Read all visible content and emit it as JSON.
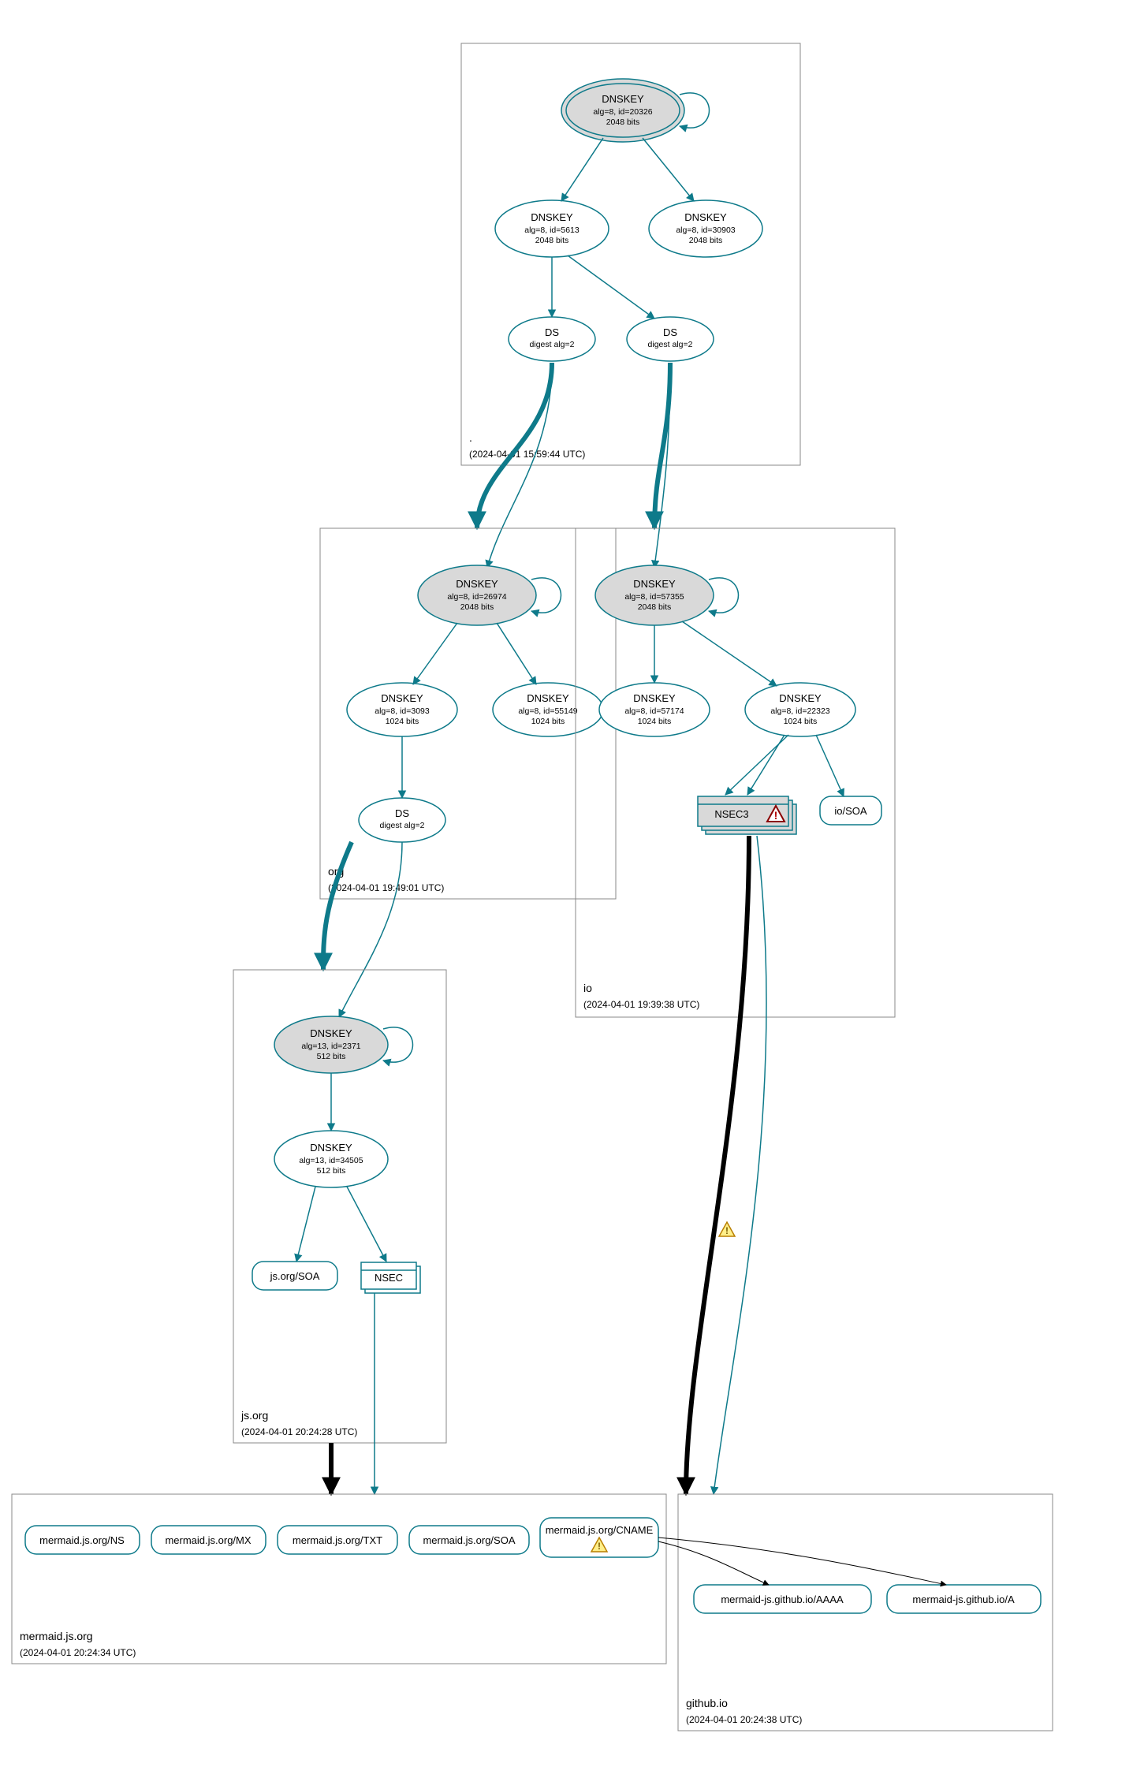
{
  "zones": {
    "root": {
      "label": ".",
      "timestamp": "(2024-04-01 15:59:44 UTC)",
      "nodes": {
        "ksk": {
          "title": "DNSKEY",
          "sub1": "alg=8, id=20326",
          "sub2": "2048 bits"
        },
        "zsk1": {
          "title": "DNSKEY",
          "sub1": "alg=8, id=5613",
          "sub2": "2048 bits"
        },
        "zsk2": {
          "title": "DNSKEY",
          "sub1": "alg=8, id=30903",
          "sub2": "2048 bits"
        },
        "ds1": {
          "title": "DS",
          "sub1": "digest alg=2"
        },
        "ds2": {
          "title": "DS",
          "sub1": "digest alg=2"
        }
      }
    },
    "org": {
      "label": "org",
      "timestamp": "(2024-04-01 19:49:01 UTC)",
      "nodes": {
        "ksk": {
          "title": "DNSKEY",
          "sub1": "alg=8, id=26974",
          "sub2": "2048 bits"
        },
        "zsk1": {
          "title": "DNSKEY",
          "sub1": "alg=8, id=3093",
          "sub2": "1024 bits"
        },
        "zsk2": {
          "title": "DNSKEY",
          "sub1": "alg=8, id=55149",
          "sub2": "1024 bits"
        },
        "ds": {
          "title": "DS",
          "sub1": "digest alg=2"
        }
      }
    },
    "io": {
      "label": "io",
      "timestamp": "(2024-04-01 19:39:38 UTC)",
      "nodes": {
        "ksk": {
          "title": "DNSKEY",
          "sub1": "alg=8, id=57355",
          "sub2": "2048 bits"
        },
        "zsk1": {
          "title": "DNSKEY",
          "sub1": "alg=8, id=57174",
          "sub2": "1024 bits"
        },
        "zsk2": {
          "title": "DNSKEY",
          "sub1": "alg=8, id=22323",
          "sub2": "1024 bits"
        },
        "nsec3": {
          "title": "NSEC3"
        },
        "soa": {
          "title": "io/SOA"
        }
      }
    },
    "jsorg": {
      "label": "js.org",
      "timestamp": "(2024-04-01 20:24:28 UTC)",
      "nodes": {
        "ksk": {
          "title": "DNSKEY",
          "sub1": "alg=13, id=2371",
          "sub2": "512 bits"
        },
        "zsk": {
          "title": "DNSKEY",
          "sub1": "alg=13, id=34505",
          "sub2": "512 bits"
        },
        "soa": {
          "title": "js.org/SOA"
        },
        "nsec": {
          "title": "NSEC"
        }
      }
    },
    "mermaid": {
      "label": "mermaid.js.org",
      "timestamp": "(2024-04-01 20:24:34 UTC)",
      "nodes": {
        "ns": {
          "title": "mermaid.js.org/NS"
        },
        "mx": {
          "title": "mermaid.js.org/MX"
        },
        "txt": {
          "title": "mermaid.js.org/TXT"
        },
        "soa": {
          "title": "mermaid.js.org/SOA"
        },
        "cname": {
          "title": "mermaid.js.org/CNAME"
        }
      }
    },
    "github": {
      "label": "github.io",
      "timestamp": "(2024-04-01 20:24:38 UTC)",
      "nodes": {
        "aaaa": {
          "title": "mermaid-js.github.io/AAAA"
        },
        "a": {
          "title": "mermaid-js.github.io/A"
        }
      }
    }
  }
}
